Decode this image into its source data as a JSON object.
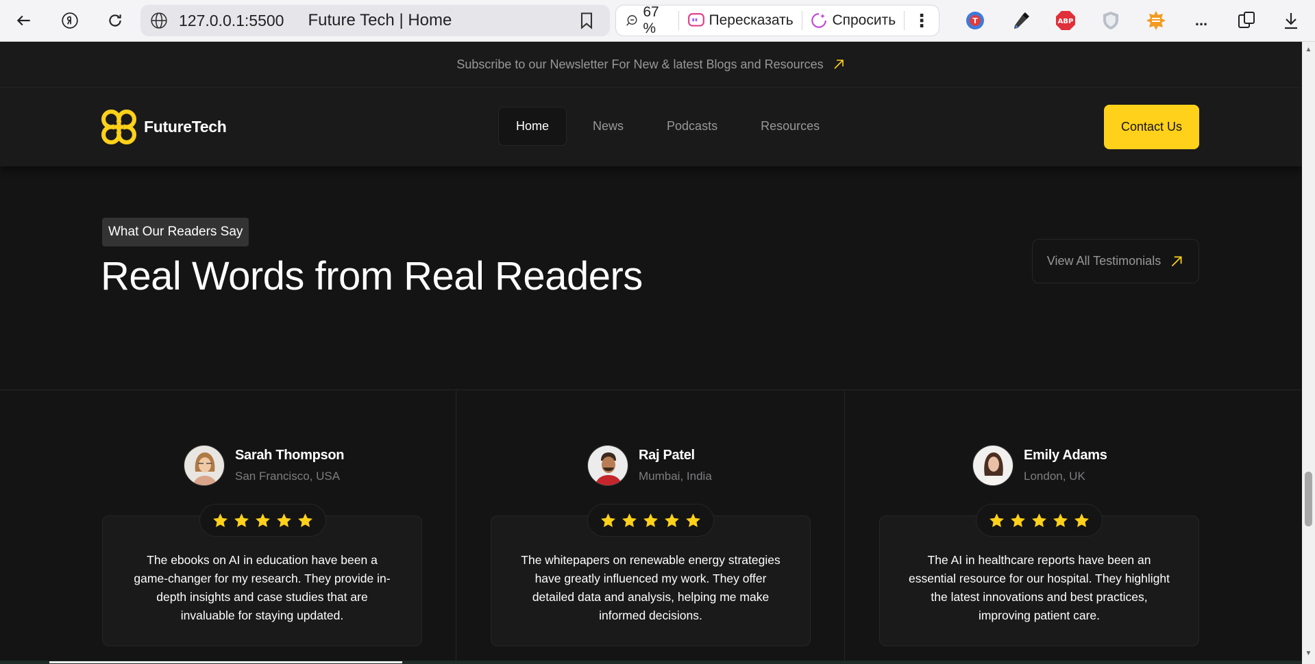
{
  "browser": {
    "url": "127.0.0.1:5500",
    "tab_title": "Future Tech | Home",
    "zoom": "67 %",
    "retell_label": "Пересказать",
    "ask_label": "Спросить",
    "more_label": "...",
    "icons": [
      "back-icon",
      "yandex-icon",
      "reload-icon",
      "globe-icon",
      "bookmark-icon",
      "zoom-icon",
      "retell-icon",
      "ask-icon",
      "menu-dots-icon",
      "translate-icon",
      "eyedropper-icon",
      "adblock-icon",
      "shield-icon",
      "sun-icon",
      "extensions-icon",
      "download-icon"
    ]
  },
  "newsletter": {
    "text": "Subscribe to our Newsletter For New & latest Blogs and Resources"
  },
  "header": {
    "logo_text": "FutureTech",
    "nav": [
      {
        "label": "Home",
        "active": true
      },
      {
        "label": "News",
        "active": false
      },
      {
        "label": "Podcasts",
        "active": false
      },
      {
        "label": "Resources",
        "active": false
      }
    ],
    "contact_label": "Contact Us",
    "accent": "#FFD11A"
  },
  "hero": {
    "tag": "What Our Readers Say",
    "title": "Real Words from Real Readers",
    "view_all_label": "View All Testimonials"
  },
  "testimonials": [
    {
      "name": "Sarah Thompson",
      "location": "San Francisco, USA",
      "rating": 5,
      "quote": "The ebooks on AI in education have been a game-changer for my research. They provide in-depth insights and case studies that are invaluable for staying updated."
    },
    {
      "name": "Raj Patel",
      "location": "Mumbai, India",
      "rating": 5,
      "quote": "The whitepapers on renewable energy strategies have greatly influenced my work. They offer detailed data and analysis, helping me make informed decisions."
    },
    {
      "name": "Emily Adams",
      "location": "London, UK",
      "rating": 5,
      "quote": "The AI in healthcare reports have been an essential resource for our hospital. They highlight the latest innovations and best practices, improving patient care."
    }
  ]
}
